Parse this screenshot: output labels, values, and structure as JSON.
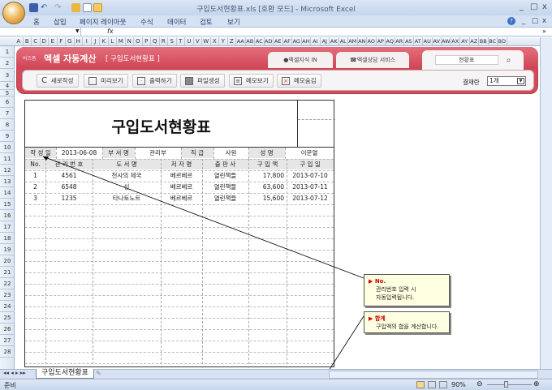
{
  "window": {
    "title": "구입도서현황표.xls  [호환 모드] - Microsoft Excel",
    "minimize": "_",
    "maximize": "□",
    "close": "x"
  },
  "ribbon": {
    "tabs": [
      "홈",
      "삽입",
      "페이지 레이아웃",
      "수식",
      "데이터",
      "검토",
      "보기"
    ],
    "help": "?"
  },
  "formula_bar": {
    "fx": "fx",
    "name_box": "",
    "value": ""
  },
  "columns": [
    "A",
    "B",
    "C",
    "D",
    "E",
    "F",
    "G",
    "H",
    "I",
    "J",
    "K",
    "L",
    "M",
    "N",
    "O",
    "P",
    "Q",
    "R",
    "S",
    "T",
    "U",
    "V",
    "W",
    "X",
    "Y",
    "Z",
    "AA",
    "AB",
    "AC",
    "AD",
    "AE",
    "AF",
    "AG",
    "AH",
    "AI",
    "AJ",
    "AK",
    "AL",
    "AM",
    "AN",
    "AO",
    "AP",
    "AQ",
    "AR",
    "AS",
    "AT",
    "AU",
    "AV",
    "AW",
    "AX",
    "AY",
    "AZ",
    "BB",
    "BC",
    "BD"
  ],
  "rows": [
    "1",
    "2",
    "3",
    "4",
    "5",
    "6",
    "7",
    "8",
    "9",
    "10",
    "11",
    "12",
    "13",
    "14",
    "15",
    "16",
    "17",
    "18",
    "19",
    "20",
    "21",
    "22",
    "23",
    "24",
    "25",
    "26",
    "27",
    "28"
  ],
  "banner": {
    "brand": "비즈폼",
    "title": "엑셀 자동계산",
    "subtitle": "[ 구입도서현황표 ]",
    "tab1": "엑셀지식 IN",
    "tab2": "엑셀상담 서비스",
    "search_value": "현황표",
    "buttons": [
      "새로작성",
      "미리보기",
      "출력하기",
      "파일생성",
      "메모보기",
      "메모숨김"
    ],
    "approval_label": "결재란",
    "approval_value": "1개"
  },
  "sheet": {
    "title": "구입도서현황표",
    "info": {
      "date_label": "작 성 일",
      "date": "2013-06-08",
      "dept_label": "부 서 명",
      "dept": "관리부",
      "rank_label": "직  급",
      "rank": "사원",
      "name_label": "성  명",
      "name": "이문열"
    },
    "headers": [
      "No.",
      "관 리 번 호",
      "도   서   명",
      "저 자 명",
      "출  판  사",
      "구 입 액",
      "구  입  일"
    ],
    "records": [
      [
        "1",
        "4561",
        "천사의 제국",
        "베르베르",
        "열린책들",
        "17,800",
        "2013-07-10"
      ],
      [
        "2",
        "6548",
        "신",
        "베르베르",
        "열린책들",
        "63,600",
        "2013-07-11"
      ],
      [
        "3",
        "1235",
        "타나토노트",
        "베르베르",
        "열린책들",
        "15,600",
        "2013-07-12"
      ]
    ]
  },
  "comments": [
    {
      "title": "No.",
      "text1": "관리번호 입력 시",
      "text2": "자동입력됩니다."
    },
    {
      "title": "합계",
      "text1": "구입액의 합을 계산합니다."
    }
  ],
  "sheet_tab": "구입도서현황표",
  "status": {
    "ready": "준비",
    "zoom": "90%"
  }
}
